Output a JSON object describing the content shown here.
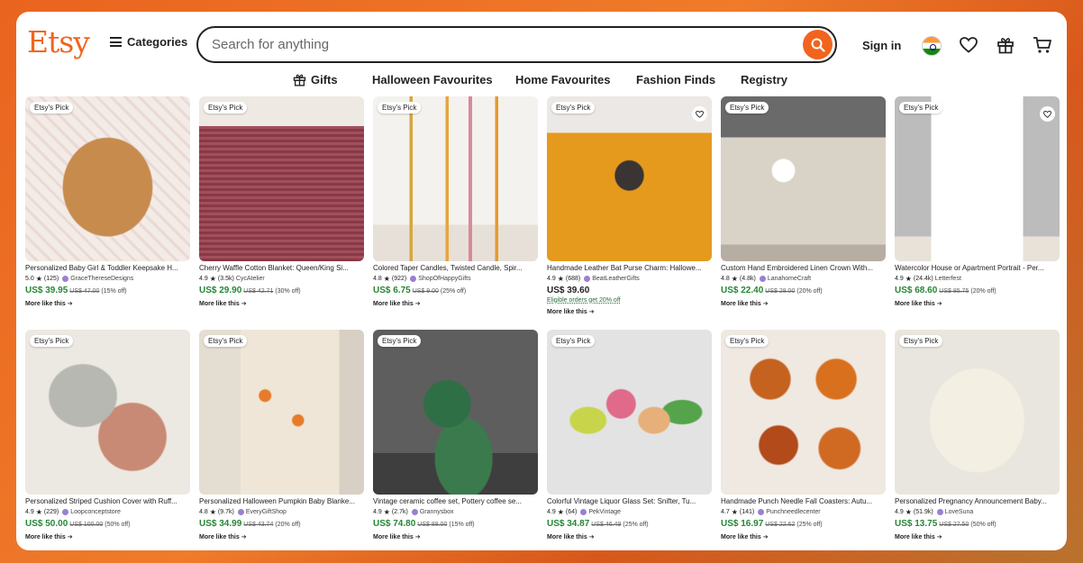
{
  "header": {
    "logo": "Etsy",
    "categories_label": "Categories",
    "search_placeholder": "Search for anything",
    "signin_label": "Sign in"
  },
  "nav": {
    "items": [
      "Gifts",
      "Halloween Favourites",
      "Home Favourites",
      "Fashion Finds",
      "Registry"
    ]
  },
  "colors": {
    "brand": "#f1641e",
    "sale_price": "#258635"
  },
  "products": [
    {
      "badge": "Etsy's Pick",
      "title": "Personalized Baby Girl & Toddler Keepsake H...",
      "rating": "5.0",
      "reviews": "(125)",
      "shop": "GraceThereseDesigns",
      "price": "US$ 39.95",
      "original": "US$ 47.00",
      "discount": "(15% off)",
      "more": "More like this"
    },
    {
      "badge": "Etsy's Pick",
      "title": "Cherry Waffle Cotton Blanket: Queen/King Si...",
      "rating": "4.9",
      "reviews": "(3.5k)",
      "shop": "CycAtelier",
      "price": "US$ 29.90",
      "original": "US$ 42.71",
      "discount": "(30% off)",
      "more": "More like this"
    },
    {
      "badge": "Etsy's Pick",
      "title": "Colored Taper Candles, Twisted Candle, Spir...",
      "rating": "4.8",
      "reviews": "(922)",
      "shop": "ShopOfHappyGifts",
      "price": "US$ 6.75",
      "original": "US$ 9.00",
      "discount": "(25% off)",
      "more": "More like this"
    },
    {
      "badge": "Etsy's Pick",
      "title": "Handmade Leather Bat Purse Charm: Hallowe...",
      "rating": "4.9",
      "reviews": "(688)",
      "shop": "BeatLeatherGifts",
      "price": "US$ 39.60",
      "original": "",
      "discount": "",
      "promo": "Eligible orders get 20% off",
      "more": "More like this"
    },
    {
      "badge": "Etsy's Pick",
      "title": "Custom Hand Embroidered Linen Crown With...",
      "rating": "4.8",
      "reviews": "(4.8k)",
      "shop": "LanahomeCraft",
      "price": "US$ 22.40",
      "original": "US$ 28.00",
      "discount": "(20% off)",
      "more": "More like this"
    },
    {
      "badge": "Etsy's Pick",
      "title": "Watercolor House or Apartment Portrait - Per...",
      "rating": "4.9",
      "reviews": "(24.4k)",
      "shop": "Letterfest",
      "price": "US$ 68.60",
      "original": "US$ 85.75",
      "discount": "(20% off)",
      "more": "More like this"
    },
    {
      "badge": "Etsy's Pick",
      "title": "Personalized Striped Cushion Cover with Ruff...",
      "rating": "4.9",
      "reviews": "(229)",
      "shop": "Loopconceptstore",
      "price": "US$ 50.00",
      "original": "US$ 100.00",
      "discount": "(50% off)",
      "more": "More like this"
    },
    {
      "badge": "Etsy's Pick",
      "title": "Personalized Halloween Pumpkin Baby Blanke...",
      "rating": "4.8",
      "reviews": "(9.7k)",
      "shop": "EveryGiftShop",
      "price": "US$ 34.99",
      "original": "US$ 43.74",
      "discount": "(20% off)",
      "more": "More like this"
    },
    {
      "badge": "Etsy's Pick",
      "title": "Vintage ceramic coffee set, Pottery coffee se...",
      "rating": "4.9",
      "reviews": "(2.7k)",
      "shop": "Grannysbox",
      "price": "US$ 74.80",
      "original": "US$ 88.00",
      "discount": "(15% off)",
      "more": "More like this"
    },
    {
      "badge": "Etsy's Pick",
      "title": "Colorful Vintage Liquor Glass Set: Snifter, Tu...",
      "rating": "4.9",
      "reviews": "(64)",
      "shop": "PekVintage",
      "price": "US$ 34.87",
      "original": "US$ 46.49",
      "discount": "(25% off)",
      "more": "More like this"
    },
    {
      "badge": "Etsy's Pick",
      "title": "Handmade Punch Needle Fall Coasters: Autu...",
      "rating": "4.7",
      "reviews": "(141)",
      "shop": "Punchneedlecenter",
      "price": "US$ 16.97",
      "original": "US$ 22.62",
      "discount": "(25% off)",
      "more": "More like this"
    },
    {
      "badge": "Etsy's Pick",
      "title": "Personalized Pregnancy Announcement Baby...",
      "rating": "4.9",
      "reviews": "(51.9k)",
      "shop": "LoveSuna",
      "price": "US$ 13.75",
      "original": "US$ 27.50",
      "discount": "(50% off)",
      "more": "More like this"
    }
  ]
}
